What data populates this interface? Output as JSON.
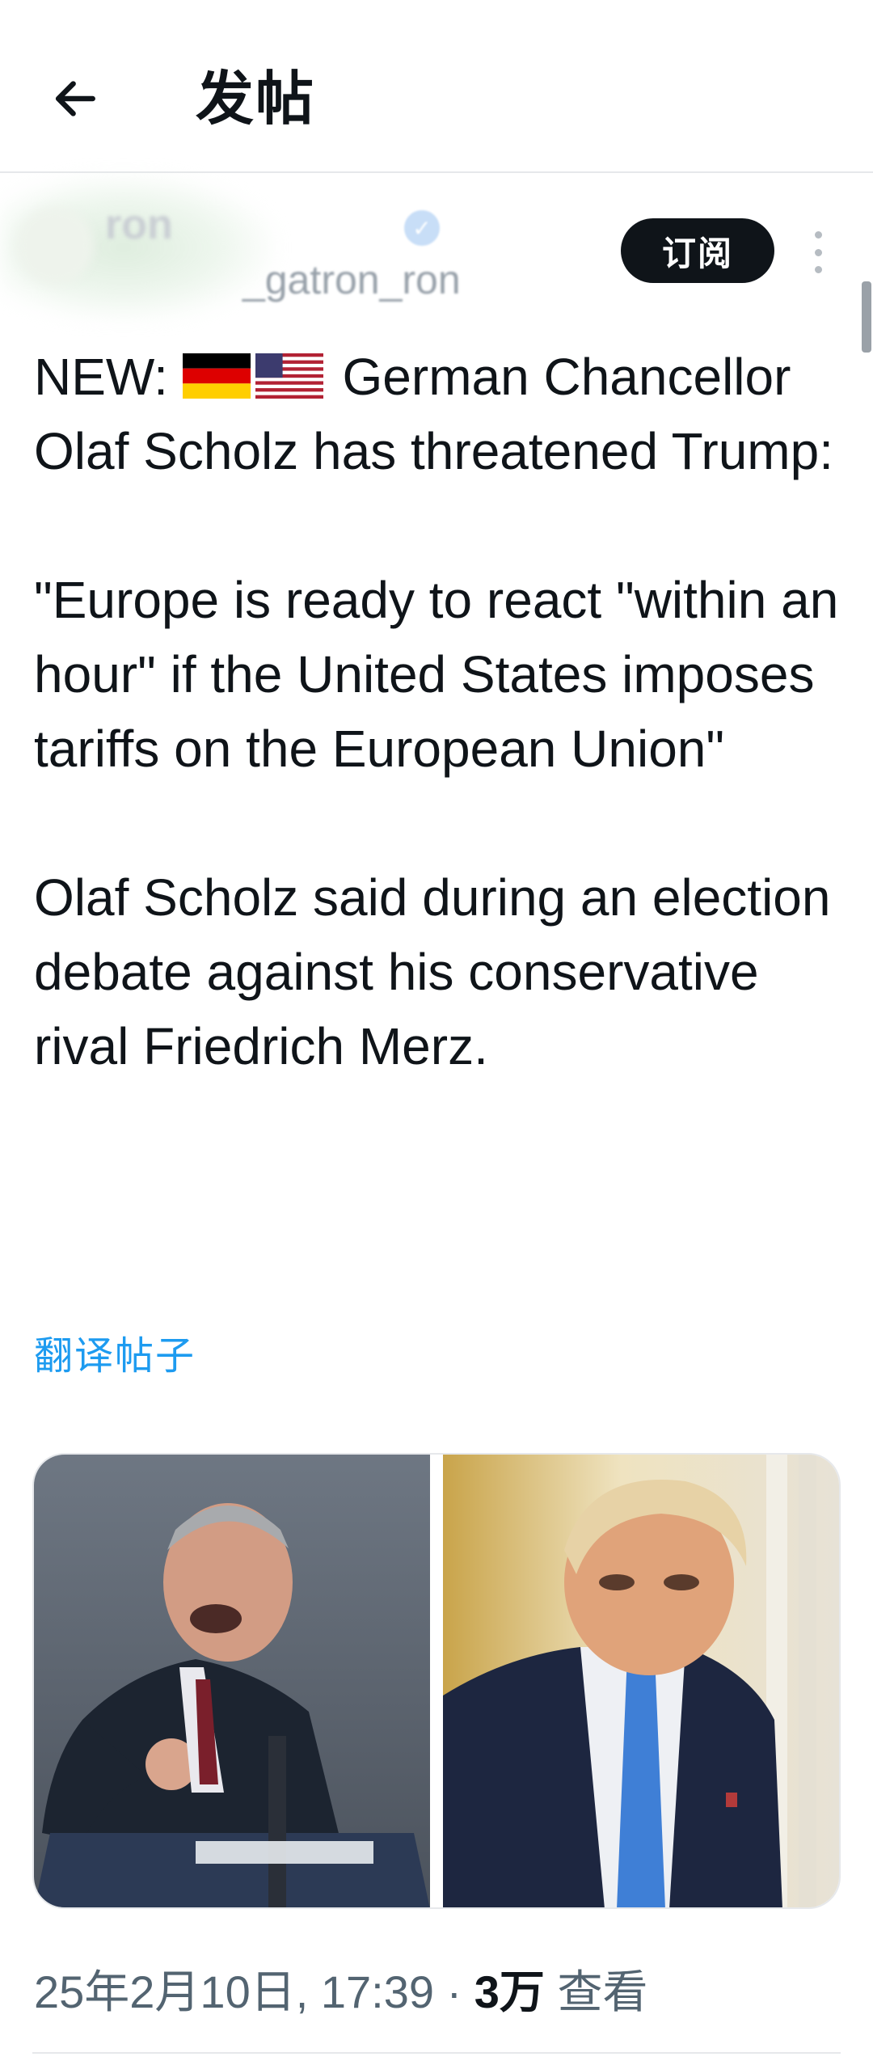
{
  "header": {
    "title": "发帖"
  },
  "author": {
    "name": "ron",
    "handle": "_gatron_ron",
    "subscribe_label": "订阅"
  },
  "tweet": {
    "line1_prefix": "NEW:",
    "line1_suffix": "German",
    "paragraph1_rest": "Chancellor Olaf Scholz has threatened Trump:",
    "paragraph2": "\"Europe is ready to react \"within an hour\" if the United States imposes tariffs on the European Union\"",
    "paragraph3": "Olaf Scholz said during an election debate against his conservative rival Friedrich Merz.",
    "translate_label": "翻译帖子"
  },
  "meta": {
    "datetime": "25年2月10日, 17:39",
    "separator": "·",
    "views_count": "3万",
    "views_label": "查看"
  },
  "icons": {
    "back": "back-arrow-icon",
    "more": "more-vertical-icon",
    "verified": "verified-badge-icon"
  },
  "colors": {
    "link": "#1d9bf0",
    "secondary_text": "#536471",
    "primary_text": "#0f1419"
  }
}
